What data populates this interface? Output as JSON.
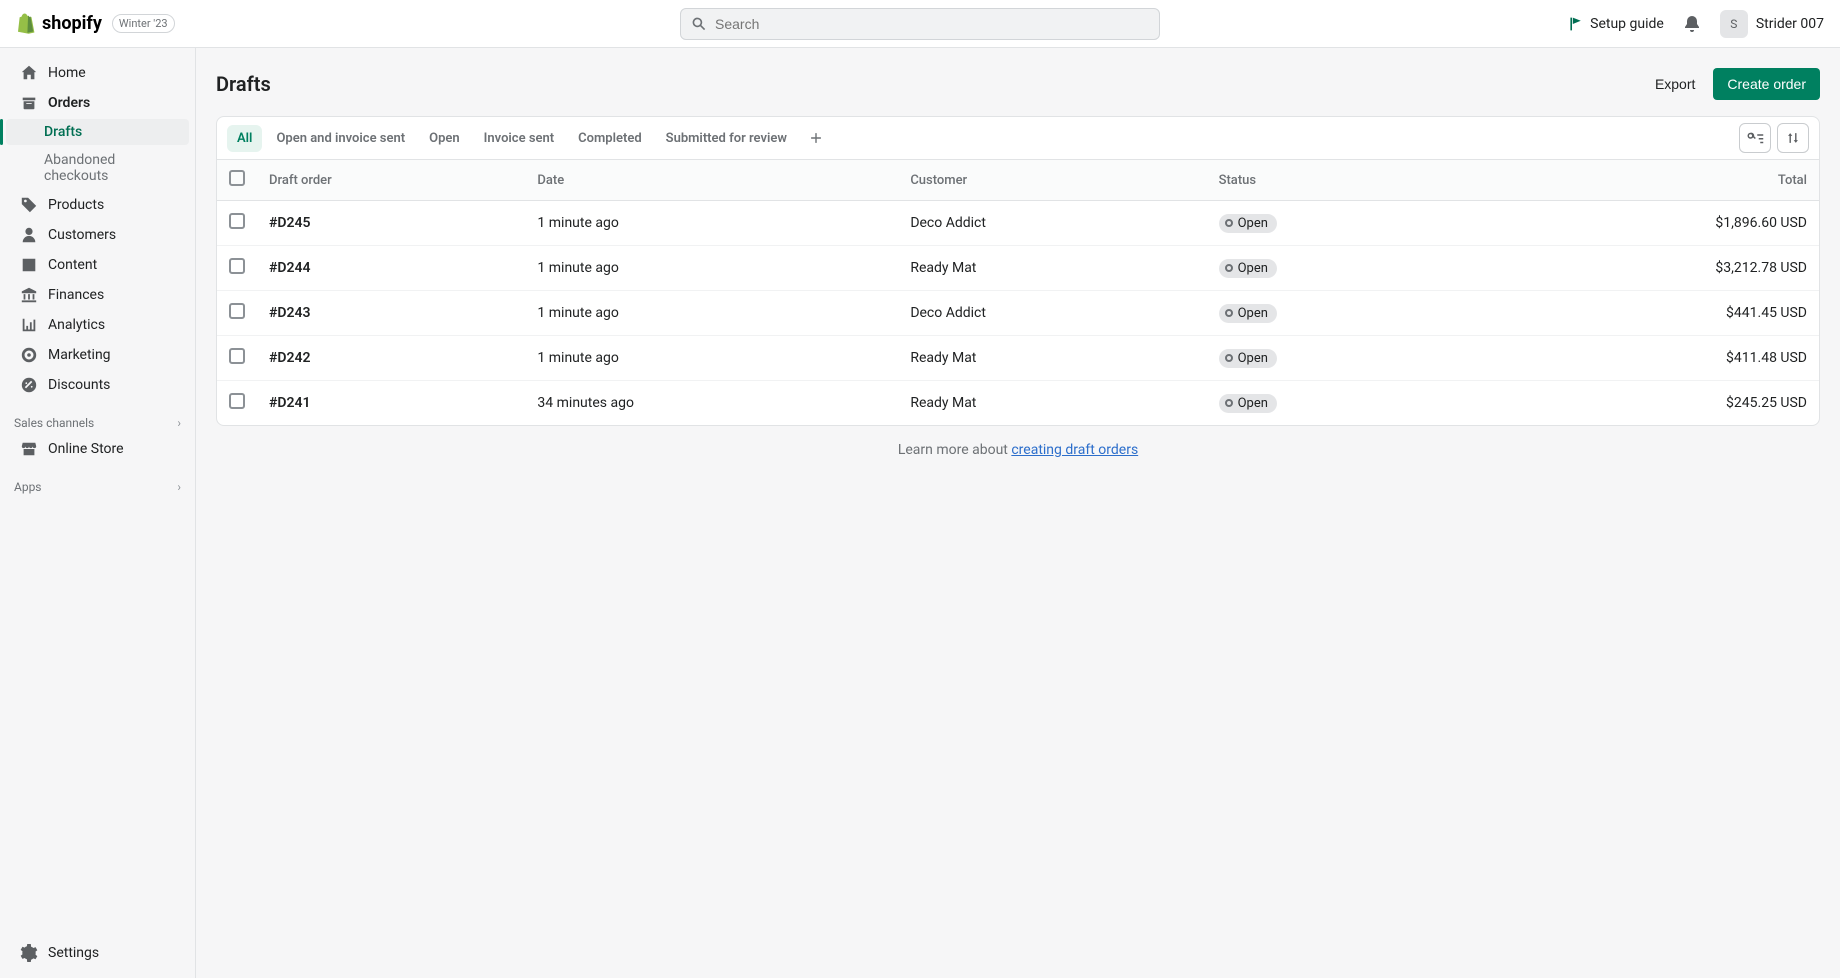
{
  "header": {
    "brand": "shopify",
    "edition": "Winter '23",
    "search_placeholder": "Search",
    "setup_guide": "Setup guide",
    "user_initial": "S",
    "user_name": "Strider 007"
  },
  "sidebar": {
    "items": [
      {
        "label": "Home",
        "icon": "home"
      },
      {
        "label": "Orders",
        "icon": "orders"
      },
      {
        "label": "Drafts",
        "sub": true,
        "active": true
      },
      {
        "label": "Abandoned checkouts",
        "sub": true
      },
      {
        "label": "Products",
        "icon": "tag"
      },
      {
        "label": "Customers",
        "icon": "person"
      },
      {
        "label": "Content",
        "icon": "image"
      },
      {
        "label": "Finances",
        "icon": "bank"
      },
      {
        "label": "Analytics",
        "icon": "analytics"
      },
      {
        "label": "Marketing",
        "icon": "target"
      },
      {
        "label": "Discounts",
        "icon": "discount"
      }
    ],
    "section_channels": "Sales channels",
    "channel_item": "Online Store",
    "section_apps": "Apps",
    "settings": "Settings"
  },
  "page": {
    "title": "Drafts",
    "export": "Export",
    "create_order": "Create order"
  },
  "tabs": [
    "All",
    "Open and invoice sent",
    "Open",
    "Invoice sent",
    "Completed",
    "Submitted for review"
  ],
  "table": {
    "headers": [
      "Draft order",
      "Date",
      "Customer",
      "Status",
      "Total"
    ],
    "rows": [
      {
        "id": "#D245",
        "date": "1 minute ago",
        "customer": "Deco Addict",
        "status": "Open",
        "total": "$1,896.60 USD"
      },
      {
        "id": "#D244",
        "date": "1 minute ago",
        "customer": "Ready Mat",
        "status": "Open",
        "total": "$3,212.78 USD"
      },
      {
        "id": "#D243",
        "date": "1 minute ago",
        "customer": "Deco Addict",
        "status": "Open",
        "total": "$441.45 USD"
      },
      {
        "id": "#D242",
        "date": "1 minute ago",
        "customer": "Ready Mat",
        "status": "Open",
        "total": "$411.48 USD"
      },
      {
        "id": "#D241",
        "date": "34 minutes ago",
        "customer": "Ready Mat",
        "status": "Open",
        "total": "$245.25 USD"
      }
    ]
  },
  "footer": {
    "learn_prefix": "Learn more about ",
    "learn_link": "creating draft orders"
  }
}
